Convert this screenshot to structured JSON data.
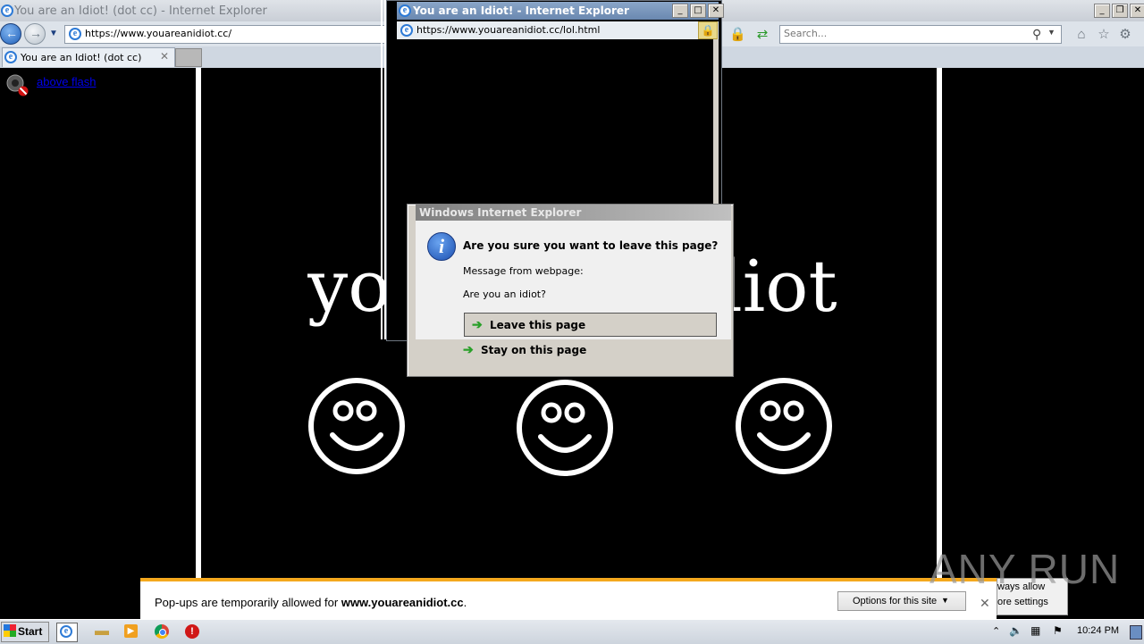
{
  "main_window": {
    "title": "You are an Idiot! (dot cc) - Internet Explorer",
    "address": "https://www.youareanidiot.cc/",
    "search_placeholder": "Search...",
    "tab_label": "You are an Idiot! (dot cc)",
    "flash_link": "above flash"
  },
  "page": {
    "big_text_left": "you",
    "big_text_right": "idiot",
    "smileys": [
      "smiley",
      "smiley",
      "smiley"
    ]
  },
  "popup_window": {
    "title": "You are an Idiot! - Internet Explorer",
    "address": "https://www.youareanidiot.cc/lol.html"
  },
  "dialog": {
    "title": "Windows Internet Explorer",
    "question": "Are you sure you want to leave this page?",
    "message_label": "Message from webpage:",
    "message": "Are you an idiot?",
    "leave_label": "Leave this page",
    "stay_label": "Stay on this page"
  },
  "notification": {
    "text_prefix": "Pop-ups are temporarily allowed for ",
    "site": "www.youareanidiot.cc",
    "text_suffix": ".",
    "options_label": "Options for this site",
    "menu_items": [
      "ways allow",
      "ore settings"
    ]
  },
  "watermark": "ANY RUN",
  "taskbar": {
    "start_label": "Start",
    "time": "10:24 PM"
  },
  "colors": {
    "notification_accent": "#f4a81d",
    "page_background": "#000000",
    "dialog_background": "#d4d0c8"
  }
}
